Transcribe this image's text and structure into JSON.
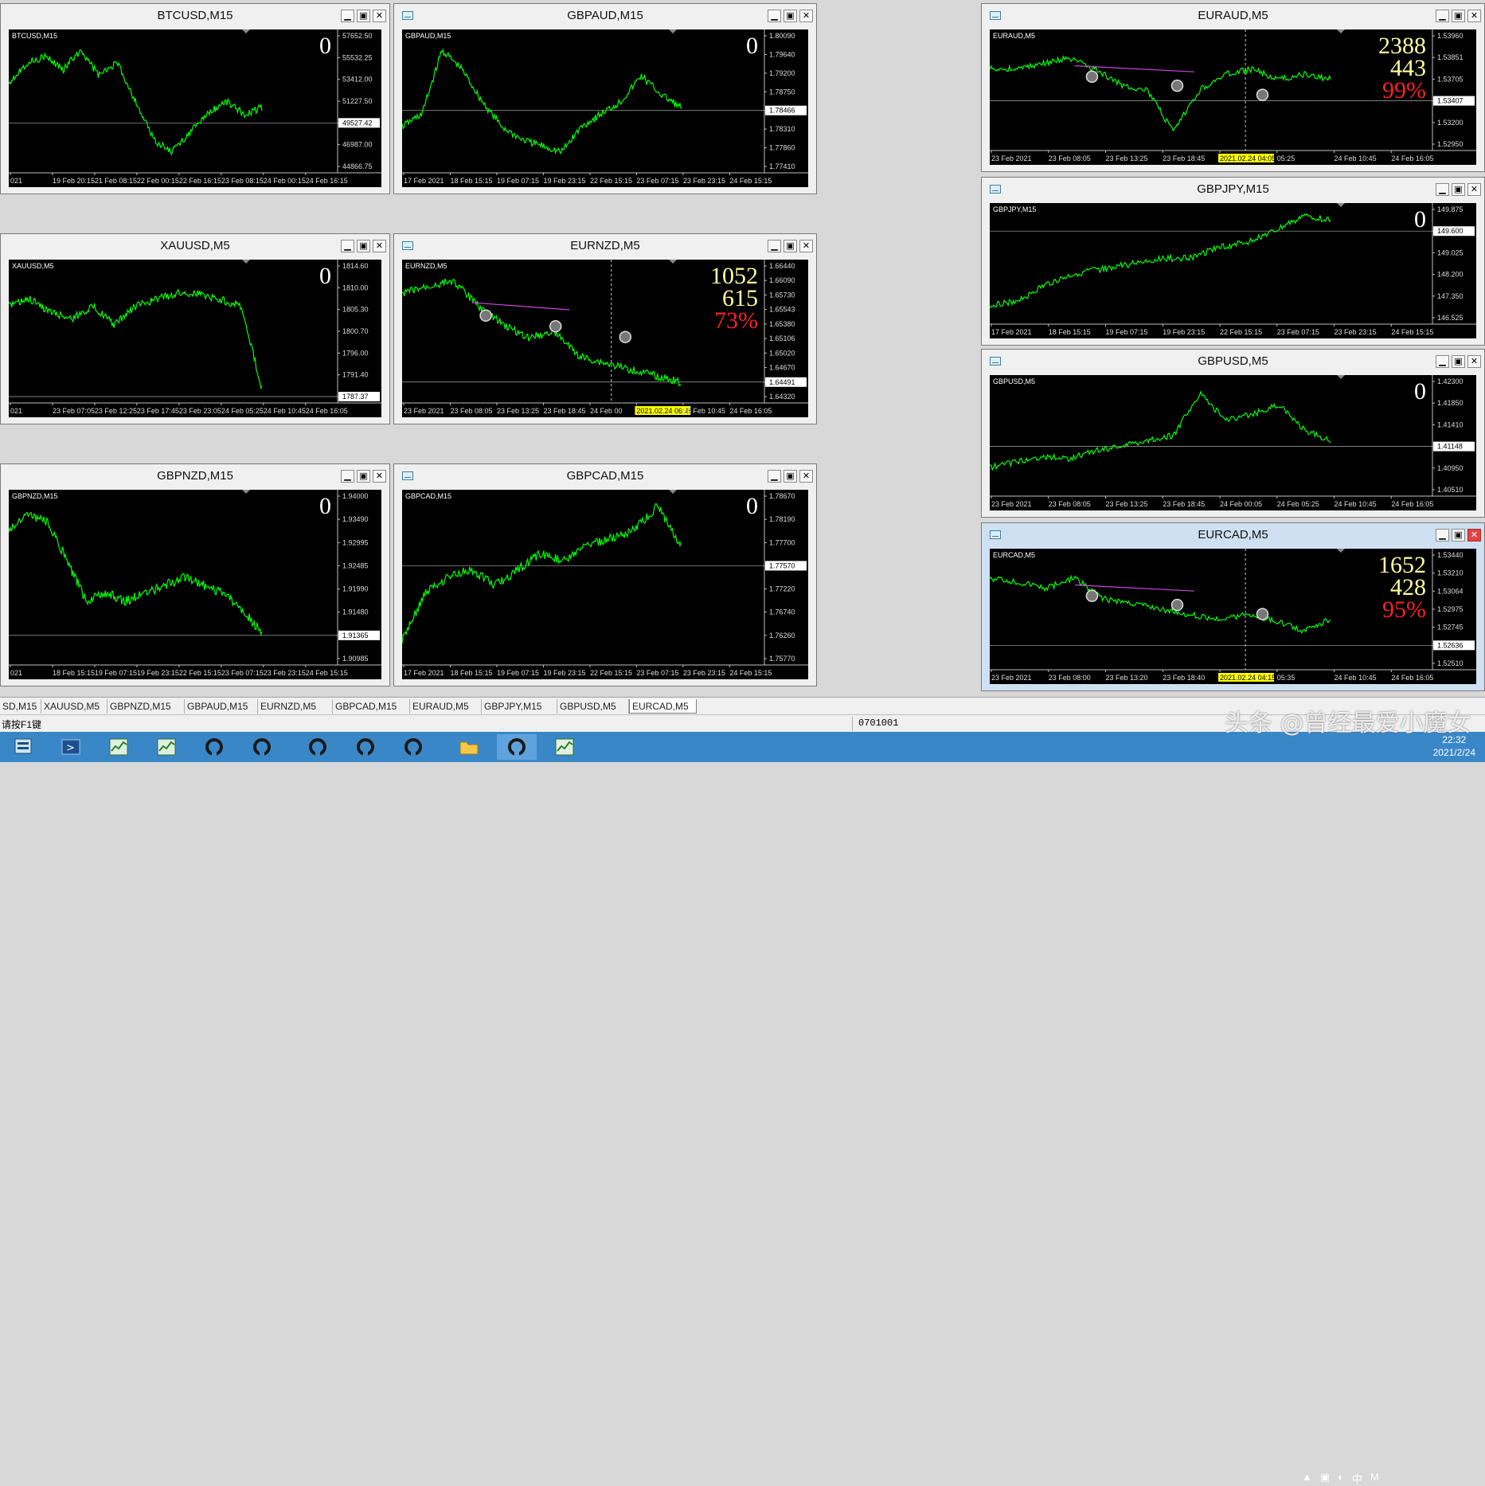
{
  "windows": [
    {
      "title": "BTCUSD,M15",
      "label": "BTCUSD,M15",
      "counter": "0",
      "prices": [
        "57652.50",
        "55532.25",
        "53412.00",
        "51227.50",
        "49527.42",
        "46987.00",
        "44866.75"
      ],
      "times": [
        "021",
        "19 Feb 20:15",
        "21 Feb 08:15",
        "22 Feb 00:15",
        "22 Feb 16:15",
        "23 Feb 08:15",
        "24 Feb 00:15",
        "24 Feb 16:15"
      ],
      "current_price": "49527.42",
      "icon": true
    },
    {
      "title": "GBPAUD,M15",
      "label": "GBPAUD,M15",
      "counter": "0",
      "prices": [
        "1.80090",
        "1.79640",
        "1.79200",
        "1.78750",
        "1.78466",
        "1.78310",
        "1.77860",
        "1.77410"
      ],
      "times": [
        "17 Feb 2021",
        "18 Feb 15:15",
        "19 Feb 07:15",
        "19 Feb 23:15",
        "22 Feb 15:15",
        "23 Feb 07:15",
        "23 Feb 23:15",
        "24 Feb 15:15"
      ],
      "current_price": "1.78466",
      "icon": true
    },
    {
      "title": "EURAUD,M5",
      "label": "EURAUD,M5",
      "counter": "2388",
      "counter2": "443",
      "percent": "99%",
      "prices": [
        "1.53960",
        "1.53851",
        "1.53705",
        "1.53407",
        "1.53200",
        "1.52950"
      ],
      "times": [
        "23 Feb 2021",
        "23 Feb 08:05",
        "23 Feb 13:25",
        "23 Feb 18:45",
        "2021.02.24 04:05",
        "05:25",
        "24 Feb 10:45",
        "24 Feb 16:05"
      ],
      "current_price": "1.53407",
      "icon": true
    },
    {
      "title": "XAUUSD,M5",
      "label": "XAUUSD,M5",
      "counter": "0",
      "prices": [
        "1814.60",
        "1810.00",
        "1805.30",
        "1800.70",
        "1796.00",
        "1791.40",
        "1787.37"
      ],
      "times": [
        "021",
        "23 Feb 07:05",
        "23 Feb 12:25",
        "23 Feb 17:45",
        "23 Feb 23:05",
        "24 Feb 05:25",
        "24 Feb 10:45",
        "24 Feb 16:05"
      ],
      "current_price": "1787.37",
      "icon": true
    },
    {
      "title": "EURNZD,M5",
      "label": "EURNZD,M5",
      "counter": "1052",
      "counter2": "615",
      "percent": "73%",
      "prices": [
        "1.66440",
        "1.66090",
        "1.65730",
        "1.65543",
        "1.65380",
        "1.65106",
        "1.65020",
        "1.64670",
        "1.64491",
        "1.64320"
      ],
      "times": [
        "23 Feb 2021",
        "23 Feb 08:05",
        "23 Feb 13:25",
        "23 Feb 18:45",
        "24 Feb 00",
        "2021.02.24 06:45",
        "24 Feb 10:45",
        "24 Feb 16:05"
      ],
      "current_price": "1.64491",
      "icon": true
    },
    {
      "title": "GBPJPY,M15",
      "label": "GBPJPY,M15",
      "counter": "0",
      "prices": [
        "149.875",
        "149.600",
        "149.025",
        "148.200",
        "147.350",
        "146.525"
      ],
      "times": [
        "17 Feb 2021",
        "18 Feb 15:15",
        "19 Feb 07:15",
        "19 Feb 23:15",
        "22 Feb 15:15",
        "23 Feb 07:15",
        "23 Feb 23:15",
        "24 Feb 15:15"
      ],
      "current_price": "149.600",
      "icon": true
    },
    {
      "title": "GBPNZD,M15",
      "label": "GBPNZD,M15",
      "counter": "0",
      "prices": [
        "1.94000",
        "1.93490",
        "1.92995",
        "1.92485",
        "1.91990",
        "1.91480",
        "1.91365",
        "1.90985"
      ],
      "times": [
        "021",
        "18 Feb 15:15",
        "19 Feb 07:15",
        "19 Feb 23:15",
        "22 Feb 15:15",
        "23 Feb 07:15",
        "23 Feb 23:15",
        "24 Feb 15:15"
      ],
      "current_price": "1.91365",
      "icon": true
    },
    {
      "title": "GBPCAD,M15",
      "label": "GBPCAD,M15",
      "counter": "0",
      "prices": [
        "1.78670",
        "1.78190",
        "1.77700",
        "1.77570",
        "1.77220",
        "1.76740",
        "1.76260",
        "1.75770"
      ],
      "times": [
        "17 Feb 2021",
        "18 Feb 15:15",
        "19 Feb 07:15",
        "19 Feb 23:15",
        "22 Feb 15:15",
        "23 Feb 07:15",
        "23 Feb 23:15",
        "24 Feb 15:15"
      ],
      "current_price": "1.77570",
      "icon": true
    },
    {
      "title": "GBPUSD,M5",
      "label": "GBPUSD,M5",
      "counter": "0",
      "prices": [
        "1.42300",
        "1.41850",
        "1.41410",
        "1.41148",
        "1.40950",
        "1.40510"
      ],
      "times": [
        "23 Feb 2021",
        "23 Feb 08:05",
        "23 Feb 13:25",
        "23 Feb 18:45",
        "24 Feb 00:05",
        "24 Feb 05:25",
        "24 Feb 10:45",
        "24 Feb 16:05"
      ],
      "current_price": "1.41148",
      "icon": true
    },
    {
      "title": "EURCAD,M5",
      "label": "EURCAD,M5",
      "counter": "1652",
      "counter2": "428",
      "percent": "95%",
      "prices": [
        "1.53440",
        "1.53210",
        "1.53064",
        "1.52975",
        "1.52745",
        "1.52636",
        "1.52510"
      ],
      "times": [
        "23 Feb 2021",
        "23 Feb 08:00",
        "23 Feb 13:20",
        "23 Feb 18:40",
        "2021.02.24 04:15",
        "05:35",
        "24 Feb 10:45",
        "24 Feb 16:05"
      ],
      "current_price": "1.52636",
      "icon": true
    }
  ],
  "tabs": [
    "SD,M15",
    "XAUUSD,M5",
    "GBPNZD,M15",
    "GBPAUD,M15",
    "EURNZD,M5",
    "GBPCAD,M15",
    "EURAUD,M5",
    "GBPJPY,M15",
    "GBPUSD,M5",
    "EURCAD,M5"
  ],
  "selected_tab": "EURCAD,M5",
  "status": {
    "hint": "请按F1键",
    "field": "0701001"
  },
  "taskbar": {
    "time": "22:32",
    "date": "2021/2/24"
  },
  "watermark": "头条 @曾经最爱小魔女",
  "colors": {
    "line": "#00ff00",
    "grid": "#c0c0c0",
    "counter": "#ffffff",
    "counter_yellow": "#ffff99",
    "percent": "#ff2020",
    "highlight": "#ffff00",
    "drawing": "#cc44dd"
  }
}
